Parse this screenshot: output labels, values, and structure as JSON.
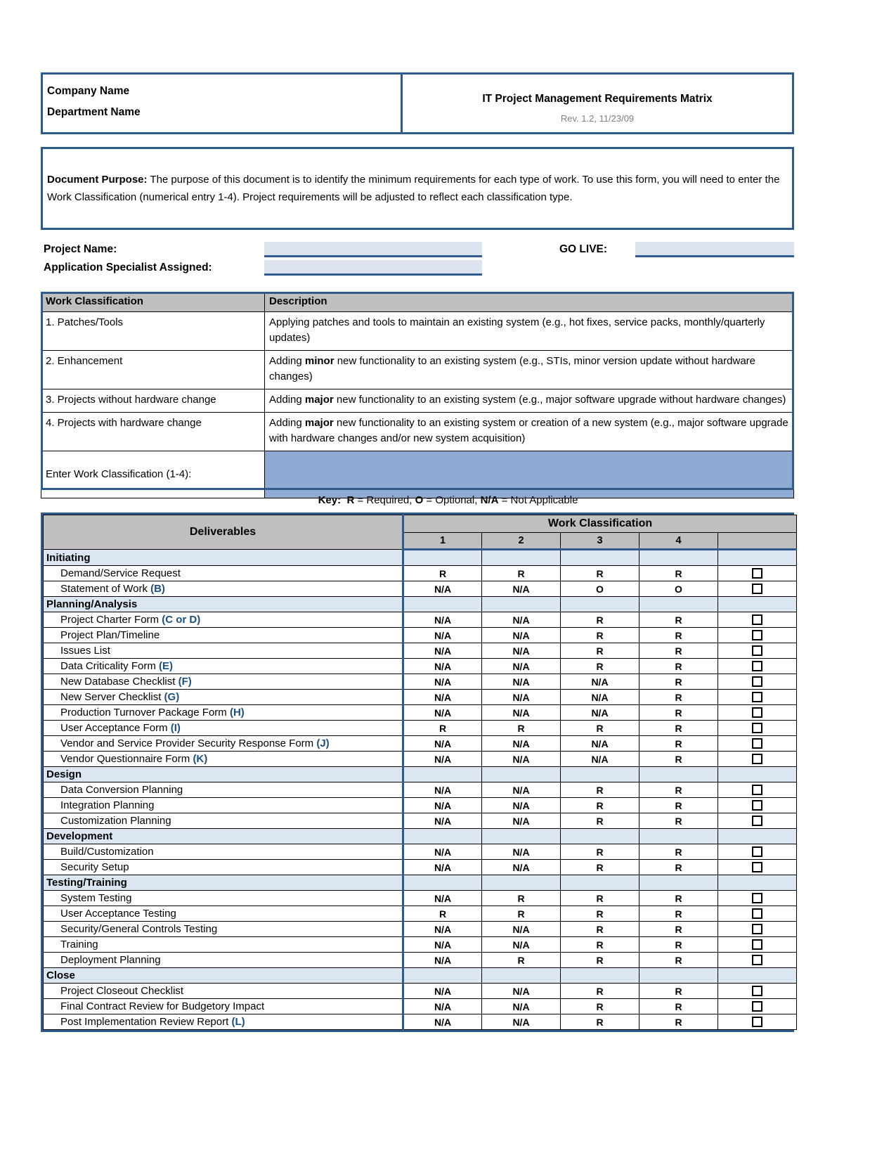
{
  "header": {
    "company_name": "Company Name",
    "department_name": "Department Name",
    "document_title": "IT Project Management Requirements Matrix",
    "revision": "Rev. 1.2, 11/23/09"
  },
  "purpose": {
    "label": "Document Purpose:",
    "text": " The purpose of this document is to identify the minimum requirements for each type of work.  To use this form, you will need to enter the Work Classification (numerical entry 1-4).  Project requirements will be adjusted to reflect each classification type."
  },
  "project_info": {
    "project_name_label": "Project Name:",
    "project_name_value": "",
    "app_specialist_label": "Application Specialist Assigned:",
    "app_specialist_value": "",
    "go_live_label": "GO LIVE:",
    "go_live_value": ""
  },
  "work_classification_table": {
    "headers": [
      "Work Classification",
      "Description"
    ],
    "rows": [
      {
        "classification": "1. Patches/Tools",
        "description_pre": "Applying patches and tools to maintain an existing system (e.g., hot fixes, service packs, monthly/quarterly updates)",
        "bold_word": "",
        "description_post": ""
      },
      {
        "classification": "2. Enhancement",
        "description_pre": "Adding ",
        "bold_word": "minor",
        "description_post": " new functionality to an existing system (e.g., STIs, minor version update without hardware changes)"
      },
      {
        "classification": "3. Projects without hardware change",
        "description_pre": "Adding ",
        "bold_word": "major",
        "description_post": " new functionality to an existing system (e.g., major software upgrade without hardware changes)"
      },
      {
        "classification": "4. Projects with hardware change",
        "description_pre": "Adding ",
        "bold_word": "major",
        "description_post": " new functionality to an existing system or creation of a new system (e.g., major software upgrade with hardware changes and/or new system acquisition)"
      }
    ],
    "entry_row_label": "Enter Work Classification (1-4):",
    "entry_row_value": ""
  },
  "key": {
    "prefix": "Key:",
    "r_symbol": "R",
    "r_text": " = Required, ",
    "o_symbol": "O",
    "o_text": " = Optional, ",
    "na_symbol": "N/A",
    "na_text": " = Not Applicable"
  },
  "deliverables_table": {
    "col_deliverables": "Deliverables",
    "col_work_classification": "Work Classification",
    "class_columns": [
      "1",
      "2",
      "3",
      "4",
      ""
    ],
    "sections": [
      {
        "name": "Initiating",
        "items": [
          {
            "label": "Demand/Service Request",
            "ref": "",
            "values": [
              "R",
              "R",
              "R",
              "R"
            ]
          },
          {
            "label": "Statement of Work ",
            "ref": "(B)",
            "values": [
              "N/A",
              "N/A",
              "O",
              "O"
            ]
          }
        ]
      },
      {
        "name": "Planning/Analysis",
        "items": [
          {
            "label": "Project Charter Form ",
            "ref": "(C or D)",
            "values": [
              "N/A",
              "N/A",
              "R",
              "R"
            ]
          },
          {
            "label": "Project Plan/Timeline",
            "ref": "",
            "values": [
              "N/A",
              "N/A",
              "R",
              "R"
            ]
          },
          {
            "label": "Issues List",
            "ref": "",
            "values": [
              "N/A",
              "N/A",
              "R",
              "R"
            ]
          },
          {
            "label": "Data Criticality Form ",
            "ref": "(E)",
            "values": [
              "N/A",
              "N/A",
              "R",
              "R"
            ]
          },
          {
            "label": "New Database Checklist ",
            "ref": "(F)",
            "values": [
              "N/A",
              "N/A",
              "N/A",
              "R"
            ]
          },
          {
            "label": "New Server Checklist ",
            "ref": "(G)",
            "values": [
              "N/A",
              "N/A",
              "N/A",
              "R"
            ]
          },
          {
            "label": "Production Turnover Package Form ",
            "ref": "(H)",
            "values": [
              "N/A",
              "N/A",
              "N/A",
              "R"
            ]
          },
          {
            "label": "User Acceptance Form ",
            "ref": "(I)",
            "values": [
              "R",
              "R",
              "R",
              "R"
            ]
          },
          {
            "label": "Vendor and Service Provider Security Response Form ",
            "ref": "(J)",
            "values": [
              "N/A",
              "N/A",
              "N/A",
              "R"
            ]
          },
          {
            "label": "Vendor Questionnaire Form ",
            "ref": "(K)",
            "values": [
              "N/A",
              "N/A",
              "N/A",
              "R"
            ]
          }
        ]
      },
      {
        "name": "Design",
        "items": [
          {
            "label": "Data Conversion Planning",
            "ref": "",
            "values": [
              "N/A",
              "N/A",
              "R",
              "R"
            ]
          },
          {
            "label": "Integration Planning",
            "ref": "",
            "values": [
              "N/A",
              "N/A",
              "R",
              "R"
            ]
          },
          {
            "label": "Customization Planning",
            "ref": "",
            "values": [
              "N/A",
              "N/A",
              "R",
              "R"
            ]
          }
        ]
      },
      {
        "name": "Development",
        "items": [
          {
            "label": "Build/Customization",
            "ref": "",
            "values": [
              "N/A",
              "N/A",
              "R",
              "R"
            ]
          },
          {
            "label": "Security Setup",
            "ref": "",
            "values": [
              "N/A",
              "N/A",
              "R",
              "R"
            ]
          }
        ]
      },
      {
        "name": "Testing/Training",
        "items": [
          {
            "label": "System Testing",
            "ref": "",
            "values": [
              "N/A",
              "R",
              "R",
              "R"
            ]
          },
          {
            "label": "User Acceptance Testing",
            "ref": "",
            "values": [
              "R",
              "R",
              "R",
              "R"
            ]
          },
          {
            "label": "Security/General Controls Testing",
            "ref": "",
            "values": [
              "N/A",
              "N/A",
              "R",
              "R"
            ]
          },
          {
            "label": "Training",
            "ref": "",
            "values": [
              "N/A",
              "N/A",
              "R",
              "R"
            ]
          },
          {
            "label": "Deployment Planning",
            "ref": "",
            "values": [
              "N/A",
              "R",
              "R",
              "R"
            ]
          }
        ]
      },
      {
        "name": "Close",
        "items": [
          {
            "label": "Project Closeout Checklist",
            "ref": "",
            "values": [
              "N/A",
              "N/A",
              "R",
              "R"
            ]
          },
          {
            "label": "Final Contract Review for Budgetory Impact",
            "ref": "",
            "values": [
              "N/A",
              "N/A",
              "R",
              "R"
            ]
          },
          {
            "label": "Post Implementation Review Report ",
            "ref": "(L)",
            "values": [
              "N/A",
              "N/A",
              "R",
              "R"
            ]
          }
        ]
      }
    ]
  },
  "colors": {
    "border_blue": "#2E5B8C",
    "header_gray": "#BFBFBF",
    "section_blue": "#DCE6F2",
    "entry_blue": "#8FABD4",
    "field_blue": "#DCE4F0",
    "ref_blue": "#1F4E79"
  }
}
